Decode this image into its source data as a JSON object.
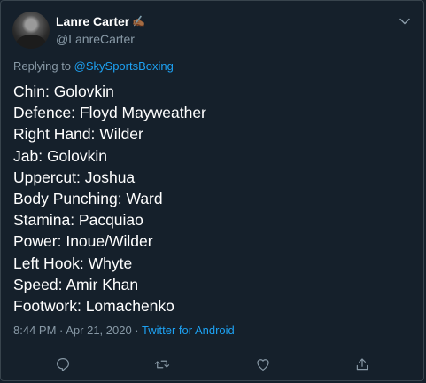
{
  "author": {
    "name": "Lanre Carter",
    "emoji": "✍🏾",
    "handle": "@LanreCarter"
  },
  "reply": {
    "prefix": "Replying to ",
    "to": "@SkySportsBoxing"
  },
  "tweet_lines": [
    "Chin: Golovkin",
    "Defence: Floyd Mayweather",
    "Right Hand: Wilder",
    "Jab: Golovkin",
    "Uppercut: Joshua",
    "Body Punching: Ward",
    "Stamina: Pacquiao",
    "Power: Inoue/Wilder",
    "Left Hook: Whyte",
    "Speed: Amir Khan",
    "Footwork: Lomachenko"
  ],
  "meta": {
    "time": "8:44 PM · Apr 21, 2020 · ",
    "source": "Twitter for Android"
  },
  "actions": [
    "reply-icon",
    "retweet-icon",
    "like-icon",
    "share-icon"
  ],
  "colors": {
    "background": "#15202b",
    "secondary_text": "#8899a6",
    "link": "#1da1f2",
    "border": "#38444d"
  }
}
